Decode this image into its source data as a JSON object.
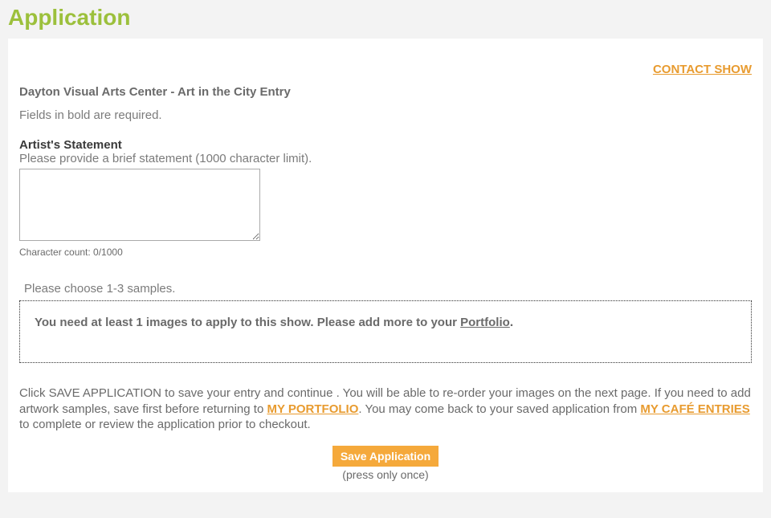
{
  "page_title": "Application",
  "contact_show_label": "CONTACT SHOW",
  "entry_title": "Dayton Visual Arts Center - Art in the City Entry",
  "required_note": "Fields in bold are required.",
  "statement": {
    "label": "Artist's Statement",
    "help": "Please provide a brief statement (1000 character limit).",
    "value": "",
    "count_prefix": "Character count: ",
    "count_value": "0/1000"
  },
  "samples": {
    "choose_note": "Please choose 1-3 samples.",
    "msg_before": "You need at least 1 images to apply to this show. Please add more to your ",
    "portfolio_link": "Portfolio",
    "msg_after": "."
  },
  "save_instructions": {
    "part1": "Click SAVE APPLICATION to save your entry and continue . You will be able to re-order your images on the next page. If you need to add artwork samples, save first before returning to ",
    "link1": "MY PORTFOLIO",
    "part2": ". You may come back to your saved application from ",
    "link2": "MY CAFÉ ENTRIES",
    "part3": " to complete or review the application prior to checkout."
  },
  "save_button": "Save Application",
  "press_once": "(press only once)"
}
